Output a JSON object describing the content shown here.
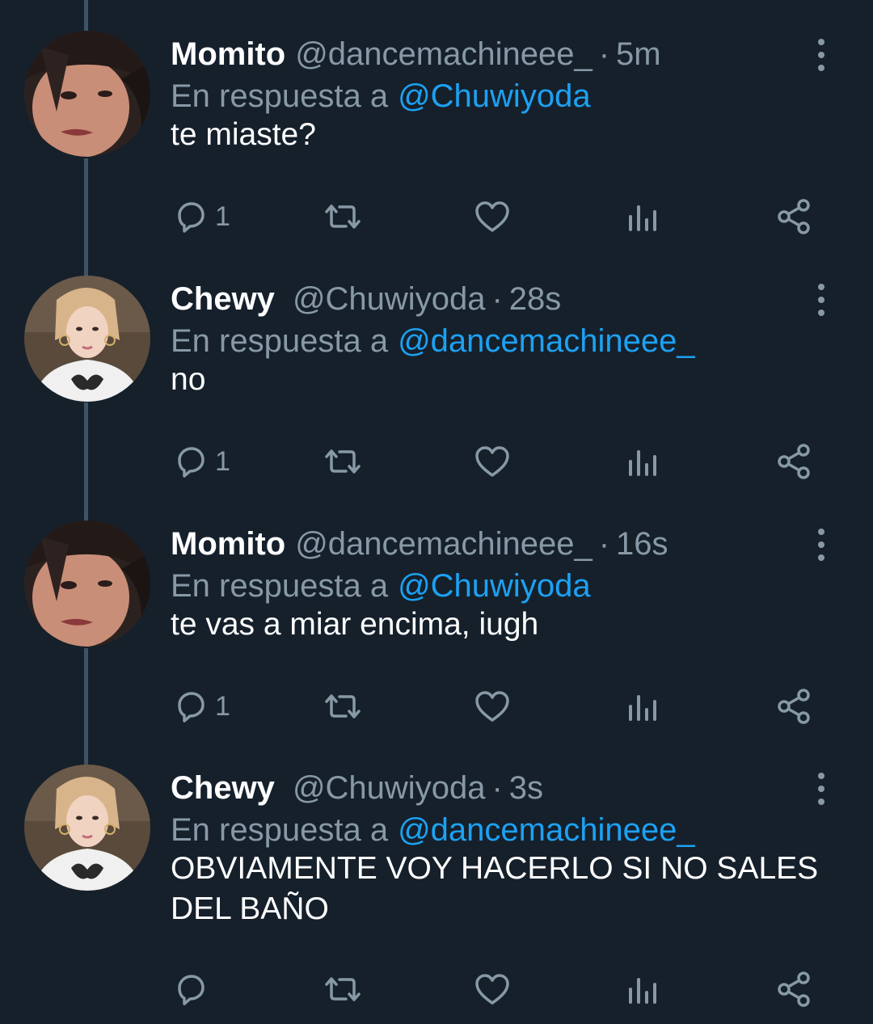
{
  "tweets": [
    {
      "name": "Momito",
      "handle": "@dancemachineee_",
      "time": "5m",
      "reply_prefix": "En respuesta a",
      "reply_to": "@Chuwiyoda",
      "text": "te miaste?",
      "reply_count": "1",
      "avatar": "avatar-momito"
    },
    {
      "name": "Chewy",
      "handle": "@Chuwiyoda",
      "time": "28s",
      "reply_prefix": "En respuesta a",
      "reply_to": "@dancemachineee_",
      "text": "no",
      "reply_count": "1",
      "avatar": "avatar-chewy"
    },
    {
      "name": "Momito",
      "handle": "@dancemachineee_",
      "time": "16s",
      "reply_prefix": "En respuesta a",
      "reply_to": "@Chuwiyoda",
      "text": "te vas a miar encima, iugh",
      "reply_count": "1",
      "avatar": "avatar-momito"
    },
    {
      "name": "Chewy",
      "handle": "@Chuwiyoda",
      "time": "3s",
      "reply_prefix": "En respuesta a",
      "reply_to": "@dancemachineee_",
      "text": "OBVIAMENTE VOY HACERLO SI NO SALES DEL BAÑO",
      "reply_count": "",
      "avatar": "avatar-chewy"
    }
  ],
  "icons": [
    "reply-icon",
    "retweet-icon",
    "like-icon",
    "analytics-icon",
    "share-icon",
    "more-options-icon"
  ],
  "colors": {
    "background": "#15202b",
    "muted": "#8899a6",
    "accent": "#1da1f2",
    "thread_line": "#3d5466",
    "text": "#ffffff"
  }
}
